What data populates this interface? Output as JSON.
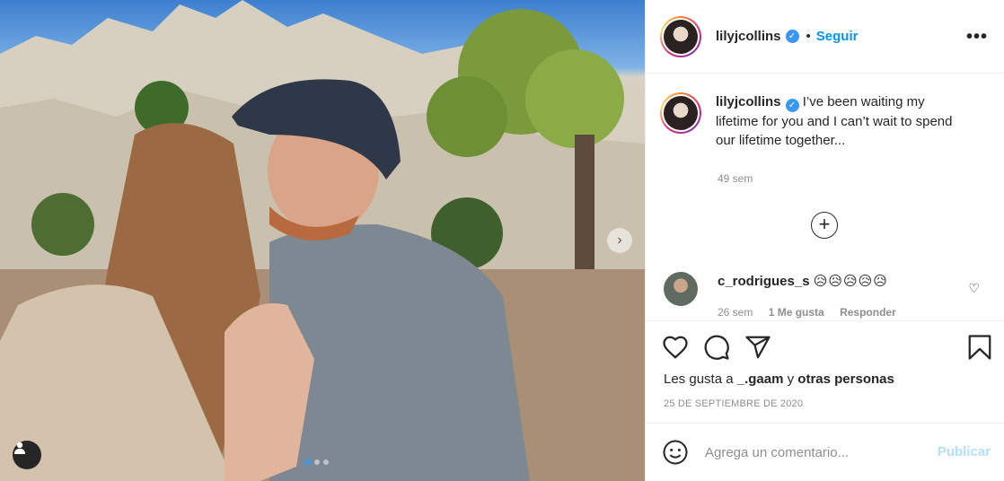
{
  "post": {
    "author": "lilyjcollins",
    "follow_label": "Seguir",
    "separator": "•",
    "more_label": "•••",
    "caption_author": "lilyjcollins",
    "caption_text": "I’ve been waiting my lifetime for you and I can’t wait to spend our lifetime together...",
    "caption_time": "49 sem",
    "load_more_label": "+"
  },
  "comments": [
    {
      "username": "c_rodrigues_s",
      "text": "😥😥😥😥😥",
      "time": "26 sem",
      "likes": "1 Me gusta",
      "reply_label": "Responder"
    }
  ],
  "likes": {
    "prefix": "Les gusta a ",
    "user": "_.gaam",
    "mid": " y ",
    "suffix": "otras personas"
  },
  "date": "25 DE SEPTIEMBRE DE 2020",
  "add_comment": {
    "placeholder": "Agrega un comentario...",
    "post_label": "Publicar"
  },
  "carousel": {
    "slides_total": 3,
    "active_slide": 1,
    "next_label": "›"
  },
  "colors": {
    "accent": "#0095f6",
    "publish_disabled": "#b2dffc",
    "muted": "#8e8e8e"
  }
}
